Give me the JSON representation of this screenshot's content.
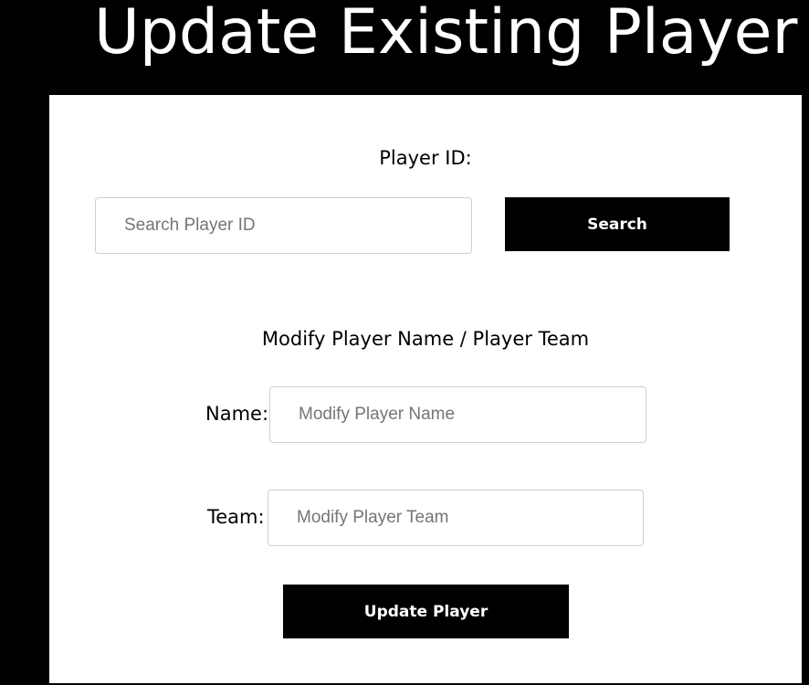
{
  "page": {
    "title": "Update Existing Player"
  },
  "search": {
    "label": "Player ID:",
    "placeholder": "Search Player ID",
    "value": "",
    "button_label": "Search"
  },
  "modify": {
    "heading": "Modify Player Name / Player Team",
    "name_label": "Name:",
    "name_placeholder": "Modify Player Name",
    "name_value": "",
    "team_label": "Team:",
    "team_placeholder": "Modify Player Team",
    "team_value": "",
    "submit_label": "Update Player"
  },
  "colors": {
    "page_background": "#000000",
    "panel_background": "#ffffff",
    "button_background": "#000000",
    "button_text": "#ffffff",
    "input_border": "#cfcfcf",
    "placeholder_text": "#757575"
  }
}
